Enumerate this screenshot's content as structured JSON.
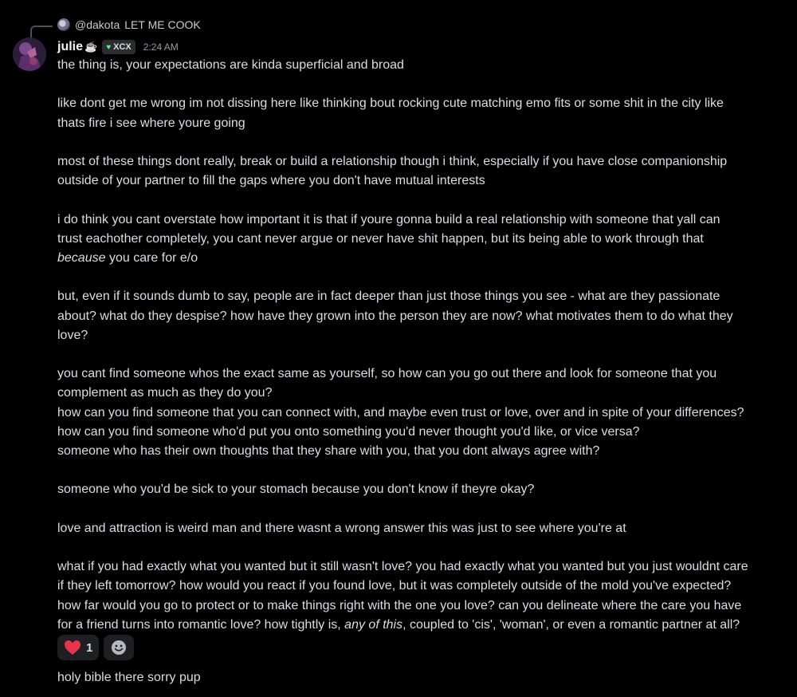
{
  "reply": {
    "name": "@dakota",
    "text": "LET ME COOK"
  },
  "author": {
    "name": "julie",
    "tag": "XCX",
    "timestamp": "2:24 AM"
  },
  "message": {
    "lines": [
      "the thing is, your expectations are kinda superficial and broad",
      "",
      "like dont get me wrong im not dissing here like thinking bout rocking cute matching emo fits or some shit in the city like",
      "thats fire i see where youre going",
      "",
      "most of these things dont really, break or build a relationship though i think, especially if you have close companionship",
      "outside of your partner to fill the gaps where you don't have mutual interests",
      "",
      "i do think you cant overstate how important it is that if youre gonna build a real relationship with someone that yall can",
      "trust eachother completely, you cant never argue or never have shit happen, but its being able to work through that"
    ],
    "because_word": "because",
    "because_rest": " you care for e/o",
    "lines2": [
      "",
      "but, even if it sounds dumb to say, people are in fact deeper than just those things you see - what are they passionate",
      "about? what do they despise? how have they grown into the person they are now? what motivates them to do what they",
      "love?",
      "",
      "you cant find someone whos the exact same as yourself, so how can you go out there and look for someone that you",
      "complement as much as they do you?",
      "how can you find someone that you can connect with, and maybe even trust or love, over and in spite of your differences?",
      "how can you find someone who'd put you onto something you'd never thought you'd like, or vice versa?",
      "someone who has their own thoughts that they share with you, that you dont always agree with?",
      "",
      "someone who you'd be sick to your stomach because you don't know if theyre okay?",
      "",
      "love and attraction is weird man and there wasnt a wrong answer this was just to see where you're at",
      "",
      "what if you had exactly what you wanted but it still wasn't love? you had exactly what you wanted but you just wouldnt care",
      "if they left tomorrow? how would you react if you found love, but it was completely outside of the mold you've expected?",
      "how far would you go to protect or to make things right with the one you love? can you delineate where the care you have"
    ],
    "last_pre": "for a friend turns into romantic love? how tightly is, ",
    "last_em": "any of this",
    "last_post": ", coupled to 'cis', 'woman', or even a romantic partner at all?"
  },
  "reactions": {
    "heart_count": "1",
    "heart_icon": "heart-icon",
    "add_icon": "add-reaction-icon"
  },
  "followup": "holy bible there sorry pup",
  "colors": {
    "background": "#000000",
    "text": "#dbdee1",
    "tag_heart": "#57f287",
    "reaction_heart": "#e8334a"
  }
}
